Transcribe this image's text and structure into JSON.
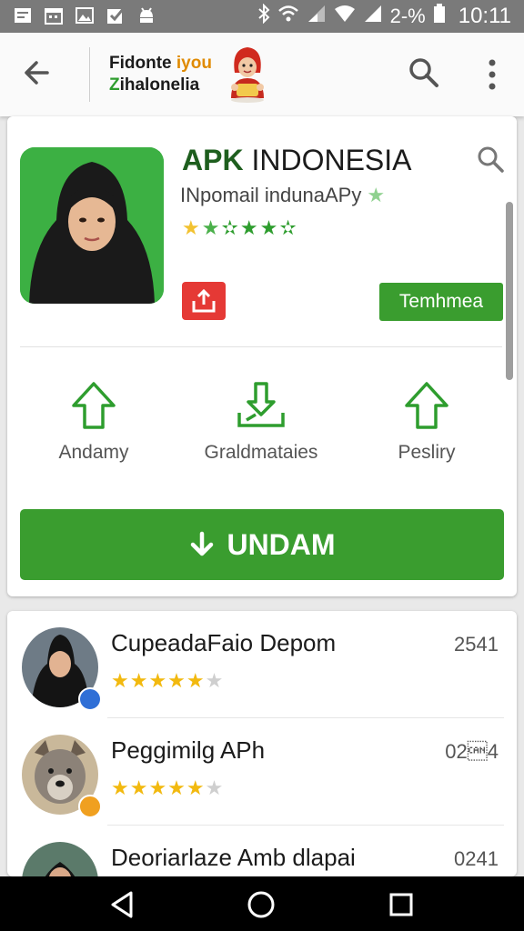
{
  "status_bar": {
    "time": "10:11",
    "battery": "2-%"
  },
  "app_bar": {
    "logo_line1": "Fidonte",
    "logo_line1_accent": "iyou",
    "logo_line2_accent": "Z",
    "logo_line2": "ihalonelia"
  },
  "app": {
    "title_bold": "APK",
    "title_rest": " INDONESIA",
    "subtitle": "INpomail indunaAPy",
    "rating_stars": 4.5,
    "secondary_button": "Temhmea"
  },
  "actions": [
    {
      "label": "Andamy",
      "icon": "arrow-up-icon"
    },
    {
      "label": "Graldmataies",
      "icon": "download-tray-icon"
    },
    {
      "label": "Pesliry",
      "icon": "arrow-up-icon"
    }
  ],
  "install_button": {
    "label": "UNDAM",
    "icon": "download-icon"
  },
  "list": [
    {
      "title": "CupeadaFaio Depom",
      "count": "2541",
      "stars": 4,
      "badge_color": "#2f6fd6"
    },
    {
      "title": "Peggimilg APh",
      "count": "02\u00184",
      "stars": 4,
      "badge_color": "#f0a020"
    },
    {
      "title": "Deoriarlaze Amb dlapai",
      "count": "0241",
      "stars": 4,
      "badge_color": "#2f6fd6"
    }
  ],
  "colors": {
    "brand_green": "#3a9d2f",
    "star_yellow": "#f2c230",
    "share_red": "#e53935"
  }
}
